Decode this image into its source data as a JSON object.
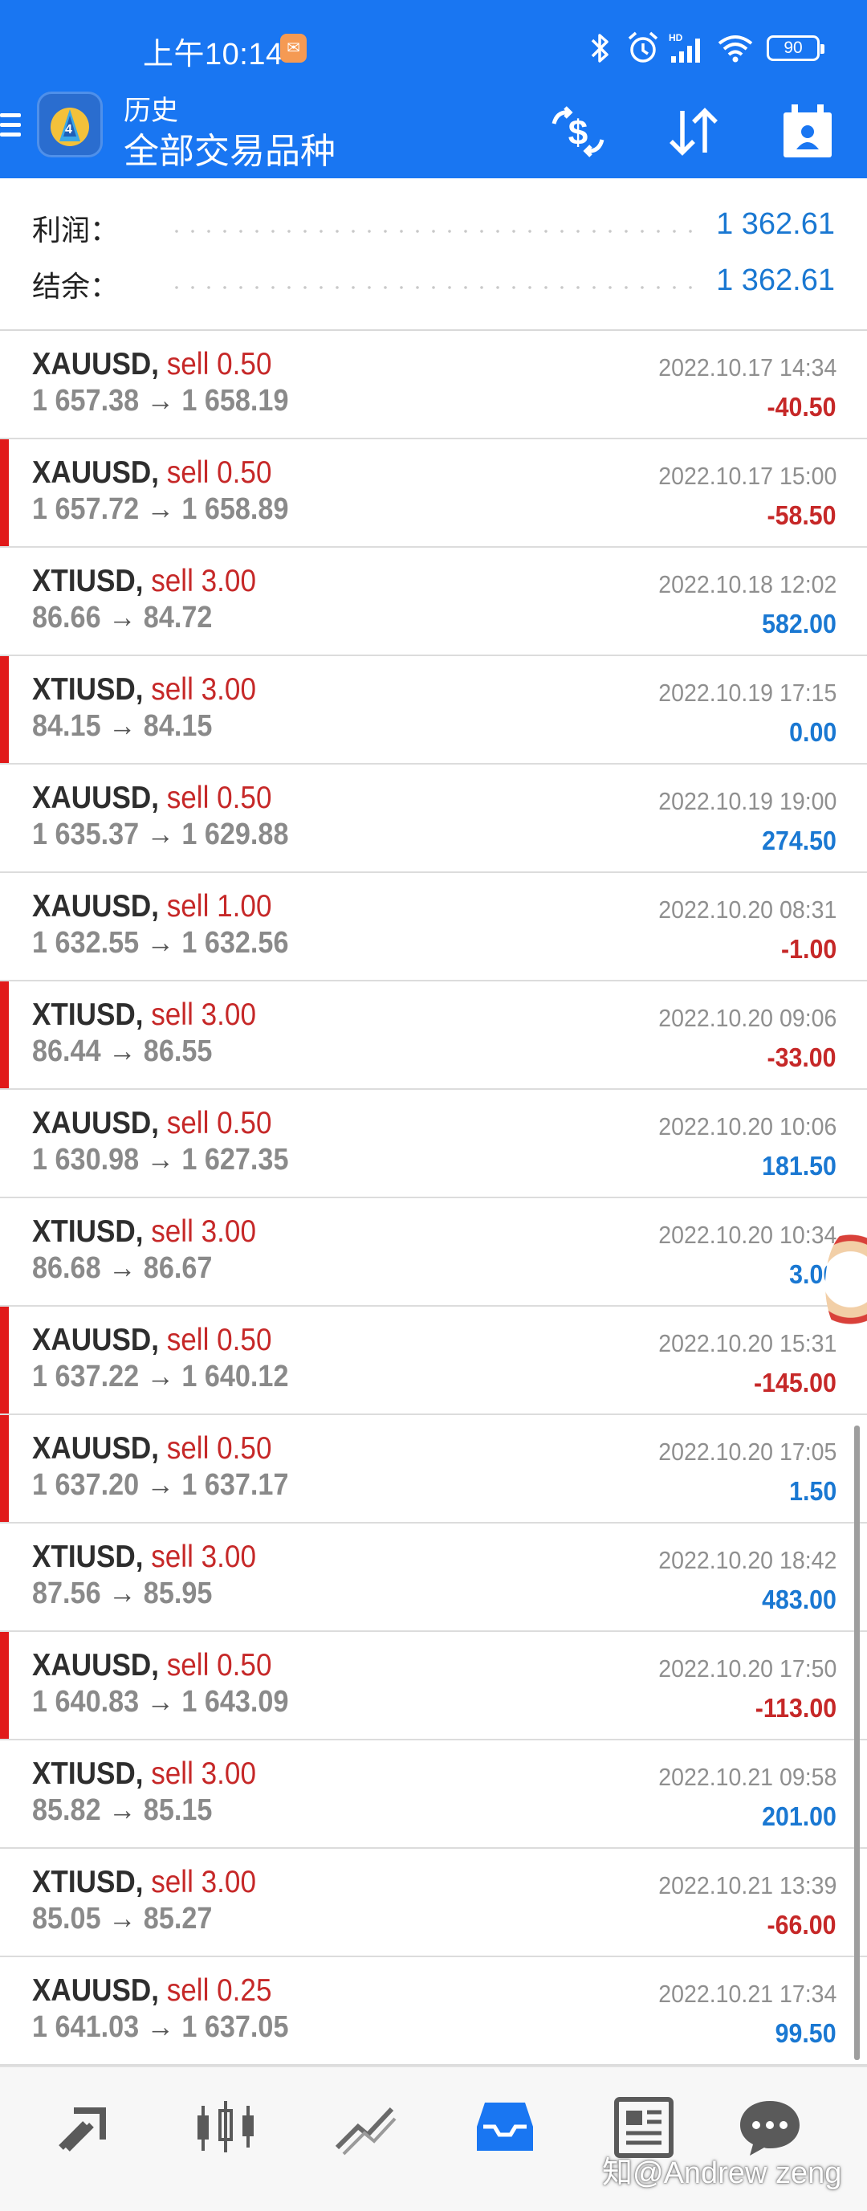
{
  "status_bar": {
    "time": "上午10:14",
    "notification_glyph": "✉",
    "battery": "90"
  },
  "app_bar": {
    "subtitle": "历史",
    "title": "全部交易品种",
    "actions": [
      "deposit-withdraw-icon",
      "sort-icon",
      "calendar-icon"
    ]
  },
  "summary": {
    "profit_label": "利润：",
    "profit_value": "1 362.61",
    "balance_label": "结余：",
    "balance_value": "1 362.61"
  },
  "deals": [
    {
      "symbol": "XAUUSD,",
      "side": "sell 0.50",
      "open": "1 657.38",
      "close": "1 658.19",
      "arrow": "→",
      "time": "2022.10.17 14:34",
      "profit": "-40.50",
      "negative": true,
      "marked": false
    },
    {
      "symbol": "XAUUSD,",
      "side": "sell 0.50",
      "open": "1 657.72",
      "close": "1 658.89",
      "arrow": "→",
      "time": "2022.10.17 15:00",
      "profit": "-58.50",
      "negative": true,
      "marked": true
    },
    {
      "symbol": "XTIUSD,",
      "side": "sell 3.00",
      "open": "86.66",
      "close": "84.72",
      "arrow": "→",
      "time": "2022.10.18 12:02",
      "profit": "582.00",
      "negative": false,
      "marked": false
    },
    {
      "symbol": "XTIUSD,",
      "side": "sell 3.00",
      "open": "84.15",
      "close": "84.15",
      "arrow": "→",
      "time": "2022.10.19 17:15",
      "profit": "0.00",
      "negative": false,
      "marked": true
    },
    {
      "symbol": "XAUUSD,",
      "side": "sell 0.50",
      "open": "1 635.37",
      "close": "1 629.88",
      "arrow": "→",
      "time": "2022.10.19 19:00",
      "profit": "274.50",
      "negative": false,
      "marked": false
    },
    {
      "symbol": "XAUUSD,",
      "side": "sell 1.00",
      "open": "1 632.55",
      "close": "1 632.56",
      "arrow": "→",
      "time": "2022.10.20 08:31",
      "profit": "-1.00",
      "negative": true,
      "marked": false
    },
    {
      "symbol": "XTIUSD,",
      "side": "sell 3.00",
      "open": "86.44",
      "close": "86.55",
      "arrow": "→",
      "time": "2022.10.20 09:06",
      "profit": "-33.00",
      "negative": true,
      "marked": true
    },
    {
      "symbol": "XAUUSD,",
      "side": "sell 0.50",
      "open": "1 630.98",
      "close": "1 627.35",
      "arrow": "→",
      "time": "2022.10.20 10:06",
      "profit": "181.50",
      "negative": false,
      "marked": false
    },
    {
      "symbol": "XTIUSD,",
      "side": "sell 3.00",
      "open": "86.68",
      "close": "86.67",
      "arrow": "→",
      "time": "2022.10.20 10:34",
      "profit": "3.00",
      "negative": false,
      "marked": false
    },
    {
      "symbol": "XAUUSD,",
      "side": "sell 0.50",
      "open": "1 637.22",
      "close": "1 640.12",
      "arrow": "→",
      "time": "2022.10.20 15:31",
      "profit": "-145.00",
      "negative": true,
      "marked": true
    },
    {
      "symbol": "XAUUSD,",
      "side": "sell 0.50",
      "open": "1 637.20",
      "close": "1 637.17",
      "arrow": "→",
      "time": "2022.10.20 17:05",
      "profit": "1.50",
      "negative": false,
      "marked": true
    },
    {
      "symbol": "XTIUSD,",
      "side": "sell 3.00",
      "open": "87.56",
      "close": "85.95",
      "arrow": "→",
      "time": "2022.10.20 18:42",
      "profit": "483.00",
      "negative": false,
      "marked": false
    },
    {
      "symbol": "XAUUSD,",
      "side": "sell 0.50",
      "open": "1 640.83",
      "close": "1 643.09",
      "arrow": "→",
      "time": "2022.10.20 17:50",
      "profit": "-113.00",
      "negative": true,
      "marked": true
    },
    {
      "symbol": "XTIUSD,",
      "side": "sell 3.00",
      "open": "85.82",
      "close": "85.15",
      "arrow": "→",
      "time": "2022.10.21 09:58",
      "profit": "201.00",
      "negative": false,
      "marked": false
    },
    {
      "symbol": "XTIUSD,",
      "side": "sell 3.00",
      "open": "85.05",
      "close": "85.27",
      "arrow": "→",
      "time": "2022.10.21 13:39",
      "profit": "-66.00",
      "negative": true,
      "marked": false
    },
    {
      "symbol": "XAUUSD,",
      "side": "sell 0.25",
      "open": "1 641.03",
      "close": "1 637.05",
      "arrow": "→",
      "time": "2022.10.21 17:34",
      "profit": "99.50",
      "negative": false,
      "marked": false
    }
  ],
  "bottom_nav": {
    "items": [
      "quotes-icon",
      "chart-icon",
      "trade-icon",
      "history-icon",
      "news-icon",
      "chat-icon"
    ],
    "active": "history-icon",
    "watermark": "知@Andrew zeng"
  },
  "colors": {
    "primary": "#1976f2",
    "loss": "#c62828",
    "profit": "#1a78d2",
    "marker": "#e11a1a"
  }
}
